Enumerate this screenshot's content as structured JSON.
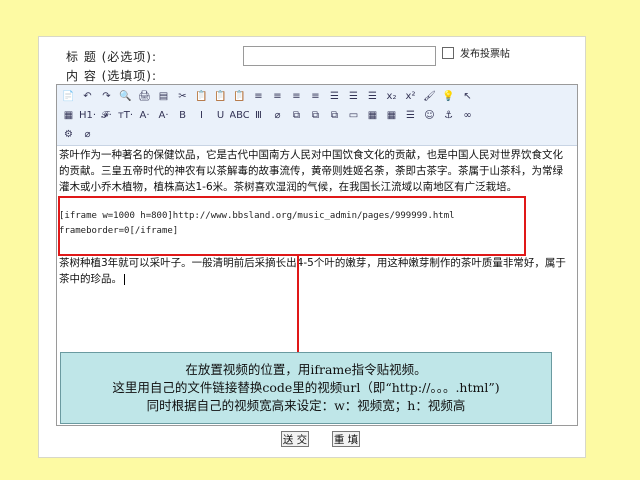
{
  "form": {
    "title_label": "标  题 (必选项):",
    "content_label": "内  容 (选填项):",
    "vote_checkbox_label": "发布投票帖"
  },
  "toolbar": {
    "row1": [
      "📄",
      "↶",
      "↷",
      "🔍",
      "🖨",
      "▤",
      "✂",
      "📋",
      "📋",
      "📋",
      "≡",
      "≡",
      "≡",
      "≡",
      "☰",
      "☰",
      "☰",
      "x₂",
      "x²",
      "🖌",
      "💡",
      "↖"
    ],
    "row2": [
      "▦",
      "H1·",
      "𝓕·",
      "тT·",
      "A·",
      "A·",
      "B",
      "I",
      "U",
      "ABC",
      "Ⅲ",
      "⌀",
      "⧉",
      "⧉",
      "⧉",
      "▭",
      "▦",
      "▦",
      "☰",
      "☺",
      "⚓",
      "∞"
    ],
    "row3": [
      "⚙",
      "⌀"
    ]
  },
  "content": {
    "para1": "茶叶作为一种著名的保健饮品，它是古代中国南方人民对中国饮食文化的贡献，也是中国人民对世界饮食文化的贡献。三皇五帝时代的神农有以茶解毒的故事流传，黄帝则姓姬名荼，荼即古茶字。茶属于山茶科，为常绿灌木或小乔木植物，植株高达1-6米。茶树喜欢湿润的气候，在我国长江流域以南地区有广泛栽培。",
    "code_line1": "[iframe w=1000 h=800]http://www.bbsland.org/music_admin/pages/999999.html",
    "code_line2": "frameborder=0[/iframe]",
    "para2": "茶树种植3年就可以采叶子。一般清明前后采摘长出4-5个叶的嫩芽，用这种嫩芽制作的茶叶质量非常好，属于茶中的珍品。"
  },
  "annotation": {
    "line1": "在放置视频的位置，用iframe指令贴视频。",
    "line2": "这里用自己的文件链接替换code里的视频url（即“http://。。。.html”)",
    "line3": "同时根据自己的视频宽高来设定：w：视频宽；h：视频高"
  },
  "buttons": {
    "submit": "送 交",
    "reset": "重 填"
  },
  "colors": {
    "background": "#fdfaa3",
    "highlight": "#e01818",
    "note_bg": "#bfe6e8"
  }
}
